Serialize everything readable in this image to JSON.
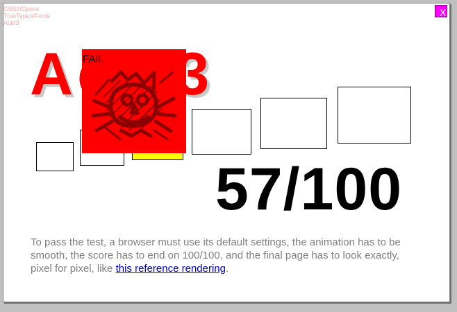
{
  "window": {
    "close_label": "X"
  },
  "status": {
    "line_1": "CSS2/Opera",
    "line_2": "TrueTypes/Fonts",
    "line_3": "Acid3"
  },
  "test": {
    "title": "Acid3",
    "fail_label": "FAIL",
    "score": "57/100",
    "fail_art_icon": "cat-face-fail-icon"
  },
  "instructions": {
    "text_before_link": "To pass the test, a browser must use its default settings, the animation has to be smooth, the score has to end on 100/100, and the final page has to look exactly, pixel for pixel, like ",
    "link_text": "this reference rendering",
    "text_after_link": "."
  },
  "colors": {
    "background": "#c0c0c0",
    "window": "#ffffff",
    "title": "#ff0000",
    "fail_panel": "#ff0000",
    "fail_art": "#8b0000",
    "yellow_box": "#ffff00",
    "close_button": "#ff00ff",
    "link": "#0000cc",
    "instruction_text": "#808080"
  }
}
